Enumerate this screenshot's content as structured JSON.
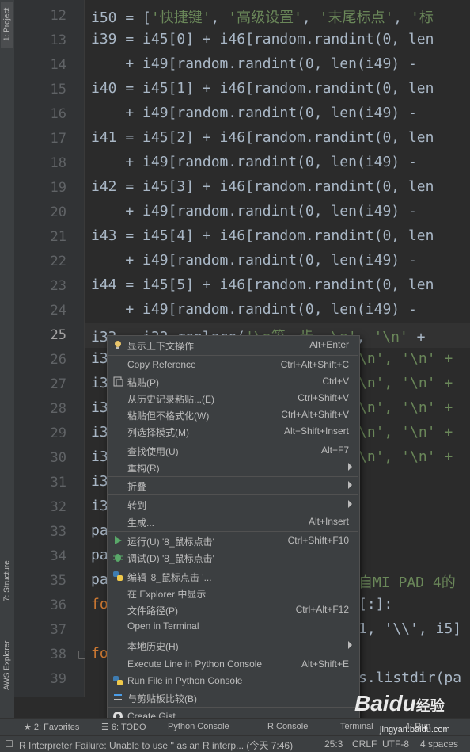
{
  "left_tabs": {
    "project": "1: Project",
    "structure": "7: Structure",
    "aws": "AWS Explorer"
  },
  "line_numbers": [
    "12",
    "13",
    "14",
    "15",
    "16",
    "17",
    "18",
    "19",
    "20",
    "21",
    "22",
    "23",
    "24",
    "25",
    "26",
    "27",
    "28",
    "29",
    "30",
    "31",
    "32",
    "33",
    "34",
    "35",
    "36",
    "37",
    "38",
    "39"
  ],
  "code_lines": {
    "l12_a": "i50 = [",
    "l12_b": "'快捷键'",
    "l12_c": ", ",
    "l12_d": "'高级设置'",
    "l12_e": ", ",
    "l12_f": "'末尾标点'",
    "l12_g": ", ",
    "l12_h": "'标",
    "l13": "i39 = i45[0] + i46[random.randint(0, len",
    "l14": "    + i49[random.randint(0, len(i49) -",
    "l15": "i40 = i45[1] + i46[random.randint(0, len",
    "l16": "    + i49[random.randint(0, len(i49) -",
    "l17": "i41 = i45[2] + i46[random.randint(0, len",
    "l18": "    + i49[random.randint(0, len(i49) -",
    "l19": "i42 = i45[3] + i46[random.randint(0, len",
    "l20": "    + i49[random.randint(0, len(i49) -",
    "l21": "i43 = i45[4] + i46[random.randint(0, len",
    "l22": "    + i49[random.randint(0, len(i49) -",
    "l23": "i44 = i45[5] + i46[random.randint(0, len",
    "l24": "    + i49[random.randint(0, len(i49) -",
    "l25_a": "i33 = i32.replace(",
    "l25_b": "'\\n第一步, \\n'",
    "l25_c": ", ",
    "l25_d": "'\\n'",
    "l25_e": " +",
    "l26": "i3",
    "l26_r": "\\n', '\\n' +",
    "l27": "i3",
    "l27_r": "\\n', '\\n' +",
    "l28": "i3",
    "l28_r": "\\n', '\\n' +",
    "l29": "i3",
    "l29_r": "\\n', '\\n' +",
    "l30": "i3",
    "l30_r": "\\n', '\\n' +",
    "l31": "i3",
    "l32": "i3",
    "l33": "pa",
    "l34": "pa",
    "l35": "pa",
    "l35_r": "自MI PAD 4的",
    "l36": "fo",
    "l36_r": "[:]:",
    "l37_r": "1, '\\\\', i5]",
    "l38": "fo",
    "l39_r": "s.listdir(pa"
  },
  "context_menu": {
    "items": [
      {
        "label": "显示上下文操作",
        "shortcut": "Alt+Enter",
        "icon": "lightbulb-icon"
      },
      {
        "label": "Copy Reference",
        "shortcut": "Ctrl+Alt+Shift+C",
        "icon": ""
      },
      {
        "label": "粘贴(P)",
        "shortcut": "Ctrl+V",
        "icon": "paste-icon"
      },
      {
        "label": "从历史记录粘贴...(E)",
        "shortcut": "Ctrl+Shift+V",
        "icon": ""
      },
      {
        "label": "粘贴但不格式化(W)",
        "shortcut": "Ctrl+Alt+Shift+V",
        "icon": ""
      },
      {
        "label": "列选择模式(M)",
        "shortcut": "Alt+Shift+Insert",
        "icon": ""
      },
      {
        "label": "查找使用(U)",
        "shortcut": "Alt+F7",
        "icon": ""
      },
      {
        "label": "重构(R)",
        "shortcut": "",
        "icon": ""
      },
      {
        "label": "折叠",
        "shortcut": "",
        "icon": ""
      },
      {
        "label": "转到",
        "shortcut": "",
        "icon": ""
      },
      {
        "label": "生成...",
        "shortcut": "Alt+Insert",
        "icon": ""
      },
      {
        "label": "运行(U) '8_鼠标点击'",
        "shortcut": "Ctrl+Shift+F10",
        "icon": "run-icon"
      },
      {
        "label": "调试(D) '8_鼠标点击'",
        "shortcut": "",
        "icon": "debug-icon"
      },
      {
        "label": "编辑 '8_鼠标点击 '...",
        "shortcut": "",
        "icon": "python-icon"
      },
      {
        "label": "在 Explorer 中显示",
        "shortcut": "",
        "icon": ""
      },
      {
        "label": "文件路径(P)",
        "shortcut": "Ctrl+Alt+F12",
        "icon": ""
      },
      {
        "label": "Open in Terminal",
        "shortcut": "",
        "icon": ""
      },
      {
        "label": "本地历史(H)",
        "shortcut": "",
        "icon": ""
      },
      {
        "label": "Execute Line in Python Console",
        "shortcut": "Alt+Shift+E",
        "icon": ""
      },
      {
        "label": "Run File in Python Console",
        "shortcut": "",
        "icon": "python-icon"
      },
      {
        "label": "与剪贴板比较(B)",
        "shortcut": "",
        "icon": "compare-icon"
      },
      {
        "label": "Create Gist...",
        "shortcut": "",
        "icon": "github-icon"
      }
    ]
  },
  "bottom_toolbar": {
    "favorites": "2: Favorites",
    "todo": "6: TODO",
    "python_console": "Python Console",
    "r_console": "R Console",
    "terminal": "Terminal",
    "run": "4: Run"
  },
  "status_bar": {
    "message": "R Interpreter Failure: Unable to use '' as an R interp... (今天 7:46)",
    "position": "25:3",
    "line_sep": "CRLF",
    "encoding": "UTF-8",
    "indent": "4 spaces"
  },
  "watermark": {
    "text": "Baidu",
    "sub": "经验",
    "url": "jingyan.baidu.com"
  },
  "colors": {
    "editor_bg": "#2b2b2b",
    "menu_bg": "#3c3f41",
    "keyword": "#cc7832",
    "string": "#6a8759",
    "number": "#6897bb",
    "builtin": "#8888c6"
  }
}
